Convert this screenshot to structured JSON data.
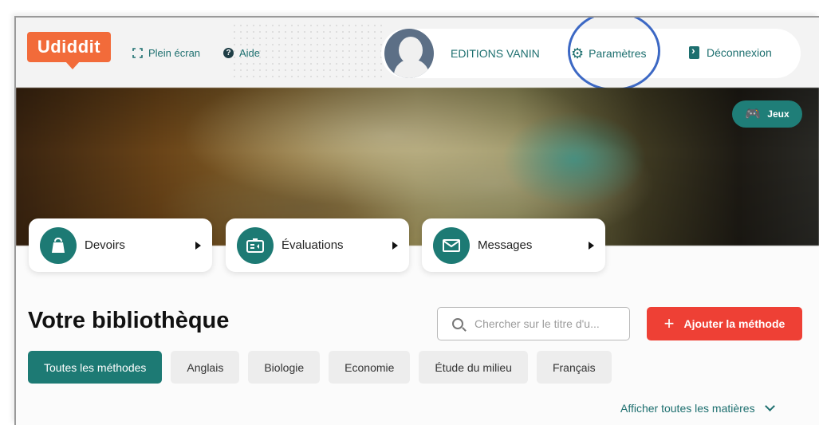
{
  "header": {
    "logo_text": "Udiddit",
    "fullscreen_label": "Plein écran",
    "help_label": "Aide",
    "username": "EDITIONS VANIN",
    "settings_label": "Paramètres",
    "logout_label": "Déconnexion"
  },
  "hero": {
    "games_label": "Jeux"
  },
  "cards": [
    {
      "label": "Devoirs",
      "icon": "bag-icon"
    },
    {
      "label": "Évaluations",
      "icon": "evaluation-icon"
    },
    {
      "label": "Messages",
      "icon": "envelope-icon"
    }
  ],
  "library": {
    "title": "Votre bibliothèque",
    "search_placeholder": "Chercher sur le titre d'u...",
    "add_label": "Ajouter la méthode",
    "filters": [
      "Toutes les méthodes",
      "Anglais",
      "Biologie",
      "Economie",
      "Étude du milieu",
      "Français"
    ],
    "active_filter": "Toutes les méthodes",
    "show_all_label": "Afficher toutes les matières"
  },
  "colors": {
    "brand_orange": "#f26b3a",
    "teal": "#1d7a74",
    "red": "#ee4035",
    "highlight_circle": "#3c68c4"
  }
}
